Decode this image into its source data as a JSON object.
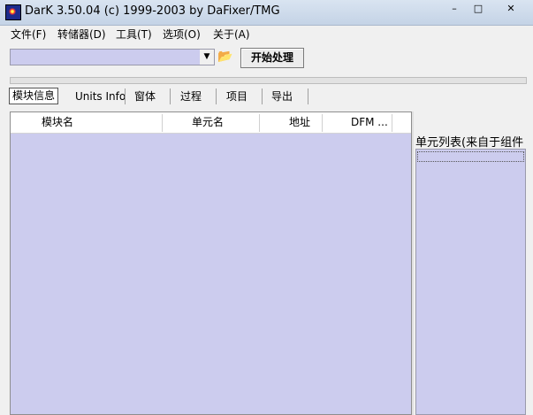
{
  "window": {
    "title": "DarK 3.50.04 (c) 1999-2003 by DaFixer/TMG",
    "icon": "dark-app-icon",
    "minimize_glyph": "–",
    "maximize_glyph": "□",
    "close_glyph": "✕"
  },
  "menu": [
    "文件(F)",
    "转储器(D)",
    "工具(T)",
    "选项(O)",
    "关于(A)"
  ],
  "toolbar": {
    "path_value": "",
    "dropdown_glyph": "▼",
    "open_icon_glyph": "📂",
    "process_label": "开始处理"
  },
  "tabs": [
    "模块信息",
    "Units Info",
    "窗体",
    "过程",
    "项目",
    "导出"
  ],
  "list": {
    "columns": [
      "模块名",
      "单元名",
      "地址",
      "DFM ..."
    ]
  },
  "right_panel": {
    "label": "单元列表(来自于组件"
  },
  "colors": {
    "list_background": "#ccccee",
    "window_background": "#f0f0f0"
  }
}
